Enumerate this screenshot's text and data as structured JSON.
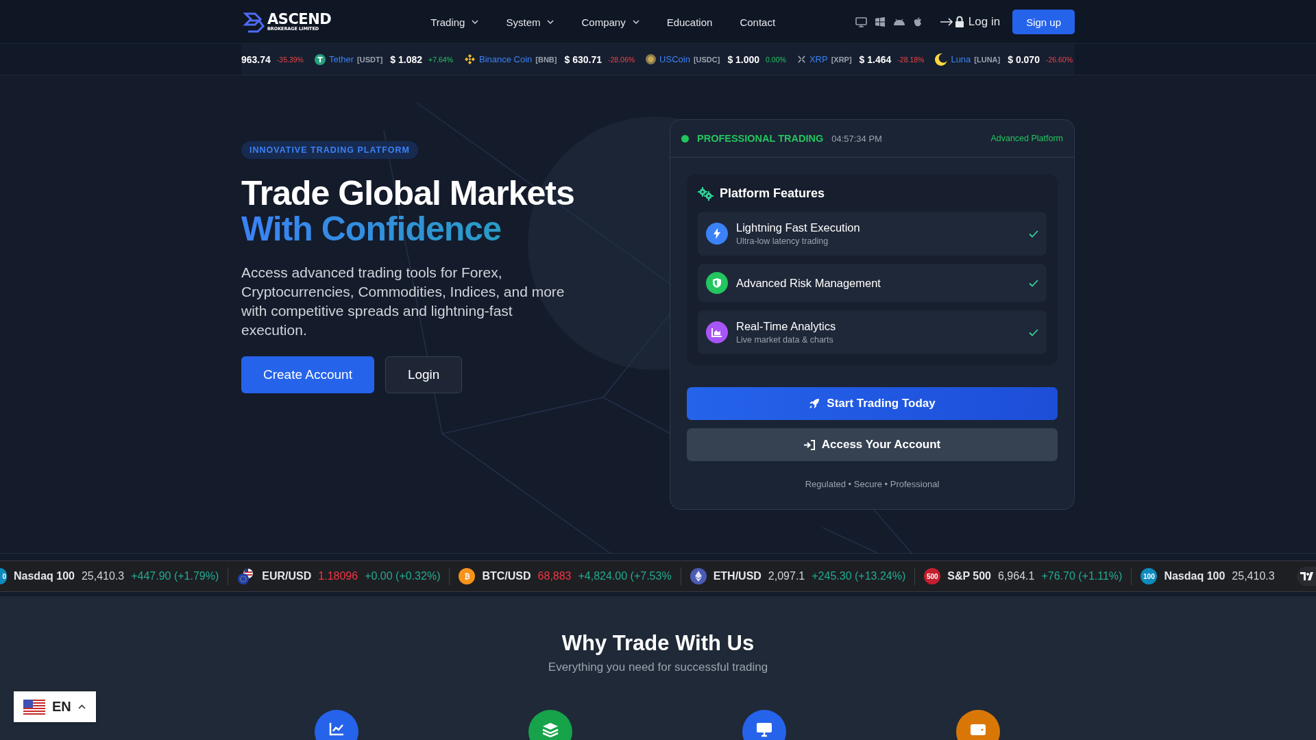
{
  "header": {
    "logo": {
      "title": "ASCEND",
      "subtitle": "BROKERAGE LIMITED"
    },
    "nav": [
      {
        "label": "Trading",
        "dropdown": true
      },
      {
        "label": "System",
        "dropdown": true
      },
      {
        "label": "Company",
        "dropdown": true
      },
      {
        "label": "Education",
        "dropdown": false
      },
      {
        "label": "Contact",
        "dropdown": false
      }
    ],
    "login": "Log in",
    "signup": "Sign up"
  },
  "top_ticker": [
    {
      "kind": "partial",
      "price": "963.74",
      "change": "-35.39%",
      "positive": false
    },
    {
      "kind": "coin",
      "name": "Tether",
      "symbol": "[USDT]",
      "price": "$ 1.082",
      "change": "+7.64%",
      "positive": true
    },
    {
      "kind": "coin",
      "name": "Binance Coin",
      "symbol": "[BNB]",
      "price": "$ 630.71",
      "change": "-28.06%",
      "positive": false
    },
    {
      "kind": "coin",
      "name": "USCoin",
      "symbol": "[USDC]",
      "price": "$ 1.000",
      "change": "0.00%",
      "positive": true
    },
    {
      "kind": "coin",
      "name": "XRP",
      "symbol": "[XRP]",
      "price": "$ 1.464",
      "change": "-28.18%",
      "positive": false
    },
    {
      "kind": "coin",
      "name": "Luna",
      "symbol": "[LUNA]",
      "price": "$ 0.070",
      "change": "-26.60%",
      "positive": false
    }
  ],
  "hero": {
    "badge": "INNOVATIVE TRADING PLATFORM",
    "title": "Trade Global Markets",
    "title_accent": "With Confidence",
    "description": "Access advanced trading tools for Forex, Cryptocurrencies, Commodities, Indices, and more with competitive spreads and lightning-fast execution.",
    "buttons": [
      {
        "label": "Create Account",
        "kind": "primary"
      },
      {
        "label": "Login",
        "kind": "secondary"
      }
    ]
  },
  "card": {
    "status": {
      "live": true,
      "label": "PROFESSIONAL TRADING",
      "time": "04:57:34 PM",
      "platform": "Advanced Platform"
    },
    "features_title": "Platform Features",
    "features": [
      {
        "title": "Lightning Fast Execution",
        "subtitle": "Ultra-low latency trading",
        "checked": true,
        "color": "#3b82f6"
      },
      {
        "title": "Advanced Risk Management",
        "checked": true,
        "color": "#22c55e"
      },
      {
        "title": "Real-Time Analytics",
        "subtitle": "Live market data & charts",
        "checked": true,
        "color": "#a855f7"
      }
    ],
    "actions": [
      {
        "label": "Start Trading Today",
        "kind": "primary"
      },
      {
        "label": "Access Your Account",
        "kind": "secondary"
      }
    ],
    "footnote": "Regulated • Secure • Professional"
  },
  "market_ticker": [
    {
      "badge": "0",
      "name": "Nasdaq 100",
      "price": "25,410.3",
      "change": "+447.90 (+1.79%)",
      "price_down": false,
      "positive": true
    },
    {
      "name": "EUR/USD",
      "price": "1.18096",
      "change": "+0.00 (+0.32%)",
      "price_down": true,
      "positive": true
    },
    {
      "badge": "₿",
      "name": "BTC/USD",
      "price": "68,883",
      "change": "+4,824.00 (+7.53%",
      "price_down": true,
      "positive": true
    },
    {
      "name": "ETH/USD",
      "price": "2,097.1",
      "change": "+245.30 (+13.24%)",
      "price_down": false,
      "positive": true
    },
    {
      "badge": "500",
      "name": "S&P 500",
      "price": "6,964.1",
      "change": "+76.70 (+1.11%)",
      "price_down": false,
      "positive": true
    },
    {
      "badge": "100",
      "name": "Nasdaq 100",
      "price": "25,410.3",
      "price_down": false
    }
  ],
  "why": {
    "title": "Why Trade With Us",
    "subtitle": "Everything you need for successful trading",
    "cards": [
      {
        "color": "#2563eb"
      },
      {
        "color": "#16a34a"
      },
      {
        "color": "#2563eb"
      },
      {
        "color": "#d97706"
      }
    ]
  },
  "language": {
    "code": "EN"
  }
}
